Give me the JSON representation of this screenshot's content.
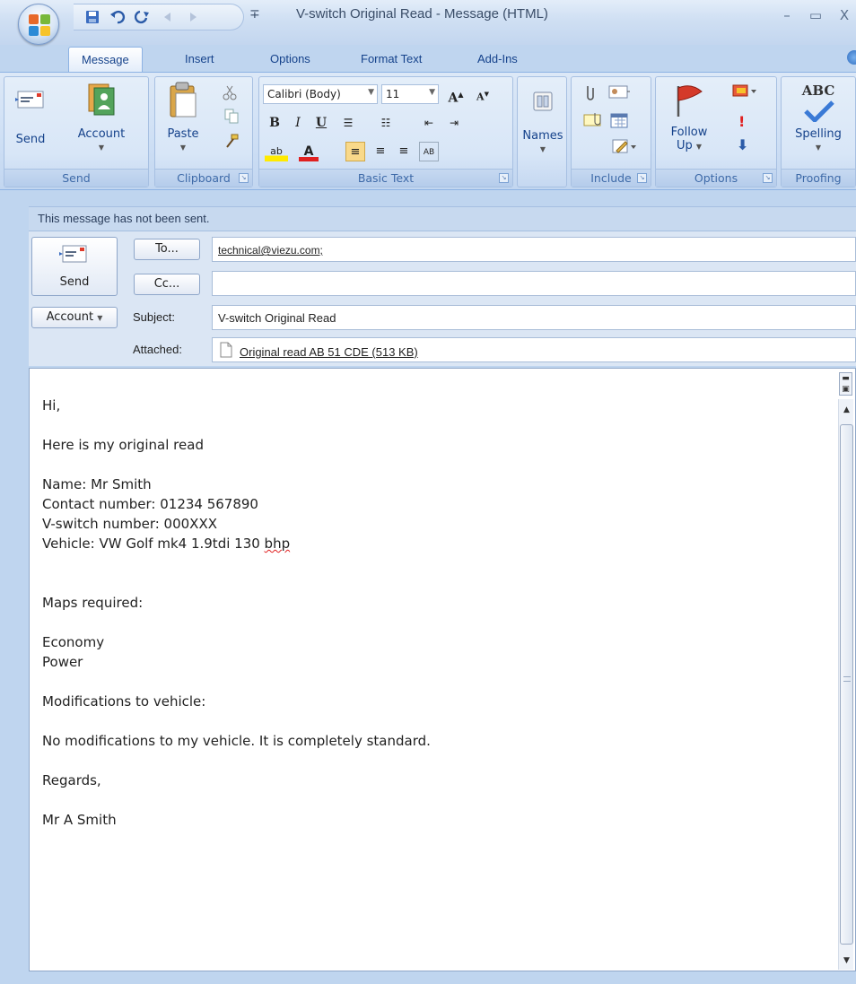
{
  "window": {
    "title": "V-switch Original Read - Message (HTML)",
    "minimize_glyph": "–",
    "maximize_glyph": "▭",
    "close_glyph": "X"
  },
  "quick_access": {
    "icons": [
      "save-icon",
      "undo-icon",
      "redo-icon",
      "previous-item-icon",
      "next-item-icon",
      "customize-qat-icon"
    ],
    "customize_glyph": "∓"
  },
  "ribbon_tabs": [
    {
      "label": "Message",
      "active": true
    },
    {
      "label": "Insert",
      "active": false
    },
    {
      "label": "Options",
      "active": false
    },
    {
      "label": "Format Text",
      "active": false
    },
    {
      "label": "Add-Ins",
      "active": false
    }
  ],
  "ribbon": {
    "send_group": {
      "label": "Send",
      "send_label": "Send",
      "account_label": "Account"
    },
    "clipboard_group": {
      "label": "Clipboard",
      "paste_label": "Paste"
    },
    "basic_text_group": {
      "label": "Basic Text",
      "font": "Calibri (Body)",
      "size": "11"
    },
    "names_group": {
      "label": "",
      "names_label": "Names"
    },
    "include_group": {
      "label": "Include"
    },
    "options_group": {
      "label": "Options",
      "follow_up_label": "Follow",
      "follow_up_label2": "Up"
    },
    "proofing_group": {
      "label": "Proofing",
      "spelling_label": "Spelling"
    }
  },
  "info_bar": "This message has not been sent.",
  "header": {
    "send_label": "Send",
    "to_button": "To...",
    "cc_button": "Cc...",
    "account_button": "Account",
    "subject_label": "Subject:",
    "attached_label": "Attached:",
    "to_value": "technical@viezu.com;",
    "cc_value": "",
    "subject_value": "V-switch Original Read",
    "attachment": "Original read AB 51 CDE (513 KB)"
  },
  "body": {
    "greeting": "Hi,",
    "intro": "Here is my original read",
    "name_line": "Name: Mr Smith",
    "contact_line": "Contact number: 01234 567890",
    "vswitch_line": "V-switch number: 000XXX",
    "vehicle_line_prefix": "Vehicle: VW Golf mk4 1.9tdi 130 ",
    "vehicle_line_misspelled": "bhp",
    "maps_heading": "Maps required:",
    "map_1": "Economy",
    "map_2": "Power",
    "mods_heading": "Modifications to vehicle:",
    "mods_text": "No modifications to my vehicle. It is completely standard.",
    "regards": "Regards,",
    "signature": "Mr A Smith"
  },
  "colors": {
    "ribbon_text": "#15428b",
    "chrome_blue": "#bfd5ef",
    "flag_red": "#d43a2a",
    "spell_underline": "#e02020"
  }
}
